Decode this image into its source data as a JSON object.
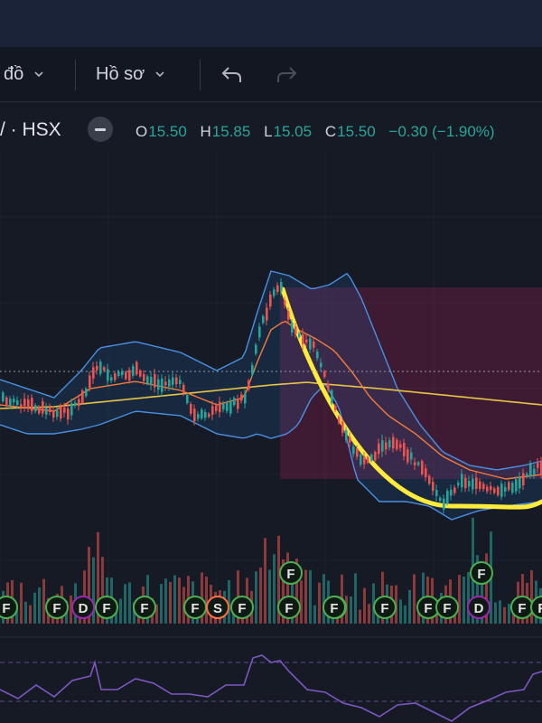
{
  "toolbar": {
    "chart_type_label": "đồ",
    "profile_label": "Hồ sơ"
  },
  "legend": {
    "symbol": "/ · HSX",
    "open_key": "O",
    "open_value": "15.50",
    "high_key": "H",
    "high_value": "15.85",
    "low_key": "L",
    "low_value": "15.05",
    "close_key": "C",
    "close_value": "15.50",
    "change": "−0.30 (−1.90%)"
  },
  "markers": {
    "events": [
      {
        "label": "F",
        "color": "#4caf50"
      },
      {
        "label": "F",
        "color": "#4caf50"
      },
      {
        "label": "D",
        "color": "#9c27b0"
      },
      {
        "label": "F",
        "color": "#4caf50"
      },
      {
        "label": "F",
        "color": "#4caf50"
      },
      {
        "label": "F",
        "color": "#4caf50"
      },
      {
        "label": "S",
        "color": "#ff7043"
      },
      {
        "label": "F",
        "color": "#4caf50"
      },
      {
        "label": "F",
        "color": "#4caf50"
      },
      {
        "label": "F",
        "color": "#4caf50"
      },
      {
        "label": "F",
        "color": "#4caf50"
      },
      {
        "label": "F",
        "color": "#4caf50"
      },
      {
        "label": "F",
        "color": "#4caf50"
      },
      {
        "label": "F",
        "color": "#4caf50"
      },
      {
        "label": "D",
        "color": "#9c27b0"
      },
      {
        "label": "F",
        "color": "#4caf50"
      },
      {
        "label": "F",
        "color": "#4caf50"
      },
      {
        "label": "F",
        "color": "#4caf50"
      },
      {
        "label": "F",
        "color": "#4caf50"
      }
    ]
  },
  "colors": {
    "up": "#26a69a",
    "down": "#ef5350",
    "bollinger": "#4a90e2",
    "ma_long": "#e8c547",
    "ma_short": "#f57c3b",
    "cup": "#ffeb3b",
    "oscillator": "#7e57c2"
  },
  "icons": [
    "chevron-down-icon",
    "undo-icon",
    "redo-icon",
    "minus-icon"
  ]
}
